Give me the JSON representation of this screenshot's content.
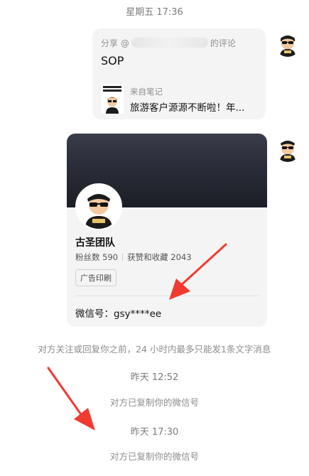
{
  "top_timestamp": "星期五 17:36",
  "share": {
    "prefix": "分享 @",
    "suffix": "的评论",
    "title": "SOP",
    "note_from": "来自笔记",
    "note_title": "旅游客户源源不断啦！年...",
    "thumb_line1": "旅游客户",
    "thumb_line2": "源源不断啦"
  },
  "profile": {
    "name": "古圣团队",
    "fans_label": "粉丝数 590",
    "likes_label": "获赞和收藏 2043",
    "tag": "广告印刷",
    "wechat": "微信号：gsy****ee"
  },
  "system_notice": "对方关注或回复你之前，24 小时内最多只能发1条文字消息",
  "events": [
    {
      "time": "昨天 12:52",
      "text": "对方已复制你的微信号"
    },
    {
      "time": "昨天 17:30",
      "text": "对方已复制你的微信号"
    }
  ],
  "colors": {
    "bubble_bg": "#f4f4f4",
    "banner_dark": "#1c1e26",
    "arrow_red": "#f03a2f",
    "muted_text": "#8d8d8d"
  }
}
